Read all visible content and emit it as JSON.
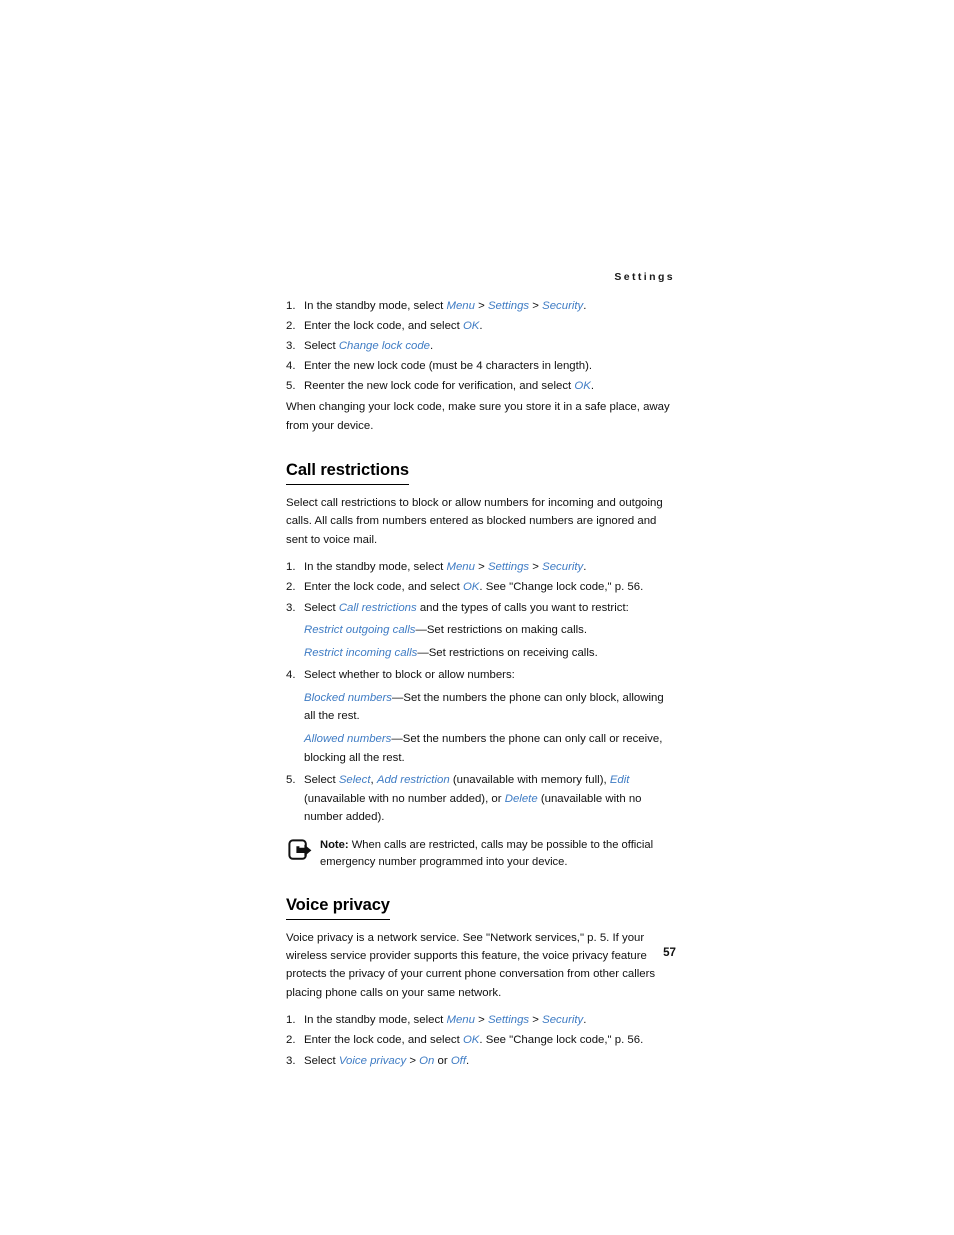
{
  "page": {
    "running_head": "Settings",
    "folio": "57"
  },
  "lock_code_steps": {
    "items": [
      {
        "num": "1.",
        "parts": [
          {
            "t": "In the standby mode, select ",
            "s": "plain"
          },
          {
            "t": "Menu",
            "s": "menu"
          },
          {
            "t": " > ",
            "s": "sep"
          },
          {
            "t": "Settings",
            "s": "menu"
          },
          {
            "t": " > ",
            "s": "sep"
          },
          {
            "t": "Security",
            "s": "menu"
          },
          {
            "t": ".",
            "s": "plain"
          }
        ]
      },
      {
        "num": "2.",
        "parts": [
          {
            "t": "Enter the lock code, and select ",
            "s": "plain"
          },
          {
            "t": "OK",
            "s": "menu"
          },
          {
            "t": ".",
            "s": "plain"
          }
        ]
      },
      {
        "num": "3.",
        "parts": [
          {
            "t": "Select ",
            "s": "plain"
          },
          {
            "t": "Change lock code",
            "s": "menu"
          },
          {
            "t": ".",
            "s": "plain"
          }
        ]
      },
      {
        "num": "4.",
        "parts": [
          {
            "t": "Enter the new lock code (must be 4 characters in length).",
            "s": "plain"
          }
        ]
      },
      {
        "num": "5.",
        "parts": [
          {
            "t": "Reenter the new lock code for verification, and select ",
            "s": "plain"
          },
          {
            "t": "OK",
            "s": "menu"
          },
          {
            "t": ".",
            "s": "plain"
          }
        ]
      }
    ],
    "trailing_paragraph": "When changing your lock code, make sure you store it in a safe place, away from your device."
  },
  "call_restrictions": {
    "heading": "Call restrictions",
    "intro": "Select call restrictions to block or allow numbers for incoming and outgoing calls. All calls from numbers entered as blocked numbers are ignored and sent to voice mail.",
    "items": [
      {
        "kind": "step",
        "num": "1.",
        "parts": [
          {
            "t": "In the standby mode, select ",
            "s": "plain"
          },
          {
            "t": "Menu",
            "s": "menu"
          },
          {
            "t": " > ",
            "s": "sep"
          },
          {
            "t": "Settings",
            "s": "menu"
          },
          {
            "t": " > ",
            "s": "sep"
          },
          {
            "t": "Security",
            "s": "menu"
          },
          {
            "t": ".",
            "s": "plain"
          }
        ]
      },
      {
        "kind": "step",
        "num": "2.",
        "parts": [
          {
            "t": "Enter the lock code, and select ",
            "s": "plain"
          },
          {
            "t": "OK",
            "s": "menu"
          },
          {
            "t": ". See \"Change lock code,\" p. 56.",
            "s": "plain"
          }
        ]
      },
      {
        "kind": "step",
        "num": "3.",
        "parts": [
          {
            "t": "Select ",
            "s": "plain"
          },
          {
            "t": "Call restrictions",
            "s": "menu"
          },
          {
            "t": " and the types of calls you want to restrict:",
            "s": "plain"
          }
        ]
      },
      {
        "kind": "sub",
        "num": "",
        "parts": [
          {
            "t": "Restrict outgoing calls",
            "s": "menu"
          },
          {
            "t": "—Set restrictions on making calls.",
            "s": "plain"
          }
        ]
      },
      {
        "kind": "sub",
        "num": "",
        "parts": [
          {
            "t": "Restrict incoming calls",
            "s": "menu"
          },
          {
            "t": "—Set restrictions on receiving calls.",
            "s": "plain"
          }
        ]
      },
      {
        "kind": "step",
        "num": "4.",
        "parts": [
          {
            "t": "Select whether to block or allow numbers:",
            "s": "plain"
          }
        ]
      },
      {
        "kind": "sub",
        "num": "",
        "parts": [
          {
            "t": "Blocked numbers",
            "s": "menu"
          },
          {
            "t": "—Set the numbers the phone can only block, allowing all the rest.",
            "s": "plain"
          }
        ]
      },
      {
        "kind": "sub",
        "num": "",
        "parts": [
          {
            "t": "Allowed numbers",
            "s": "menu"
          },
          {
            "t": "—Set the numbers the phone can only call or receive, blocking all the rest.",
            "s": "plain"
          }
        ]
      },
      {
        "kind": "step",
        "num": "5.",
        "parts": [
          {
            "t": "Select ",
            "s": "plain"
          },
          {
            "t": "Select",
            "s": "menu"
          },
          {
            "t": ", ",
            "s": "plain"
          },
          {
            "t": "Add restriction",
            "s": "menu"
          },
          {
            "t": " (unavailable with memory full), ",
            "s": "plain"
          },
          {
            "t": "Edit",
            "s": "menu"
          },
          {
            "t": " (unavailable with no number added), or ",
            "s": "plain"
          },
          {
            "t": "Delete",
            "s": "menu"
          },
          {
            "t": " (unavailable with no number added).",
            "s": "plain"
          }
        ]
      }
    ],
    "note": {
      "icon": "note-arrow-out-of-box-icon",
      "label": "Note:",
      "text": " When calls are restricted, calls may be possible to the official emergency number programmed into your device."
    }
  },
  "voice_privacy": {
    "heading": "Voice privacy",
    "intro": "Voice privacy is a network service. See \"Network services,\" p. 5. If your wireless service provider supports this feature, the voice privacy feature protects the privacy of your current phone conversation from other callers placing phone calls on your same network.",
    "items": [
      {
        "kind": "step",
        "num": "1.",
        "parts": [
          {
            "t": "In the standby mode, select ",
            "s": "plain"
          },
          {
            "t": "Menu",
            "s": "menu"
          },
          {
            "t": " > ",
            "s": "sep"
          },
          {
            "t": "Settings",
            "s": "menu"
          },
          {
            "t": " > ",
            "s": "sep"
          },
          {
            "t": "Security",
            "s": "menu"
          },
          {
            "t": ".",
            "s": "plain"
          }
        ]
      },
      {
        "kind": "step",
        "num": "2.",
        "parts": [
          {
            "t": "Enter the lock code, and select ",
            "s": "plain"
          },
          {
            "t": "OK",
            "s": "menu"
          },
          {
            "t": ". See \"Change lock code,\" p. 56.",
            "s": "plain"
          }
        ]
      },
      {
        "kind": "step",
        "num": "3.",
        "parts": [
          {
            "t": "Select ",
            "s": "plain"
          },
          {
            "t": "Voice privacy",
            "s": "menu"
          },
          {
            "t": " > ",
            "s": "sep"
          },
          {
            "t": "On",
            "s": "menu"
          },
          {
            "t": " or ",
            "s": "plain"
          },
          {
            "t": "Off",
            "s": "menu"
          },
          {
            "t": ".",
            "s": "plain"
          }
        ]
      }
    ]
  },
  "colors": {
    "menu_item_blue": "#3f7cc4",
    "body_text": "#111111",
    "page_background": "#ffffff"
  }
}
